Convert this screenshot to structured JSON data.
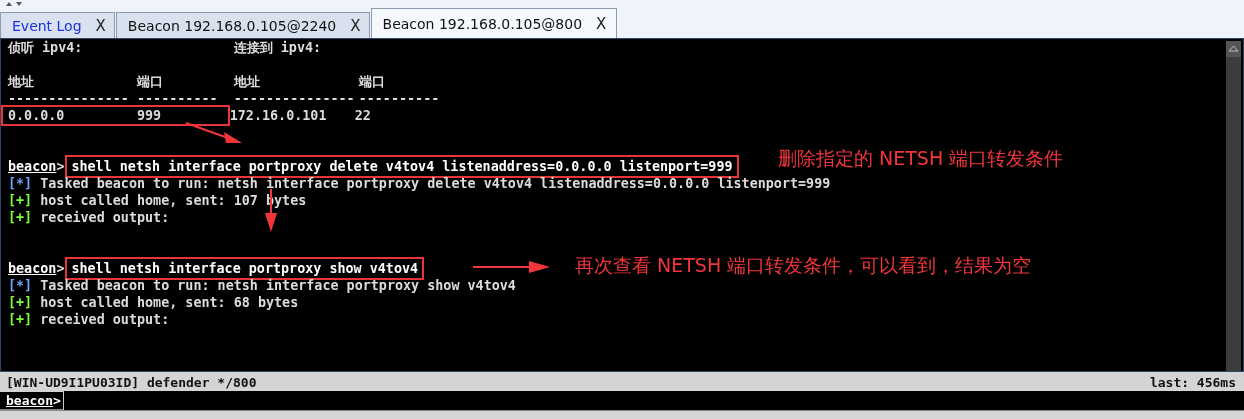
{
  "tabs": [
    {
      "label": "Event Log",
      "kind": "log",
      "close": "X",
      "selected": false
    },
    {
      "label": "Beacon 192.168.0.105@2240",
      "kind": "beacon",
      "close": "X",
      "selected": false
    },
    {
      "label": "Beacon 192.168.0.105@800",
      "kind": "beacon",
      "close": "X",
      "selected": true
    }
  ],
  "console": {
    "lines": [
      {
        "kind": "labels",
        "left": "侦听 ipv4:",
        "right": "连接到 ipv4:"
      },
      {
        "kind": "blank"
      },
      {
        "kind": "table",
        "columns": [
          {
            "header": "地址",
            "rule": "---------------"
          },
          {
            "header": "端口",
            "rule": "----------"
          },
          {
            "header": "地址",
            "rule": "---------------"
          },
          {
            "header": "端口",
            "rule": "----------"
          }
        ],
        "rows": [
          [
            {
              "text": "0.0.0.0",
              "highlighted": true
            },
            {
              "text": "999",
              "highlighted": true
            },
            {
              "text": "172.16.0.101",
              "highlighted": false
            },
            {
              "text": "22",
              "highlighted": false
            }
          ]
        ]
      },
      {
        "kind": "blank"
      },
      {
        "kind": "blank"
      },
      {
        "kind": "prompt",
        "prompt": "beacon",
        "sign": ">",
        "command": "shell netsh interface portproxy delete v4tov4 listenaddress=0.0.0.0 listenport=999",
        "highlighted": true
      },
      {
        "kind": "tasked",
        "marker": "[*]",
        "text": "Tasked beacon to run: netsh interface portproxy delete v4tov4 listenaddress=0.0.0.0 listenport=999"
      },
      {
        "kind": "info",
        "marker": "[+]",
        "text": "host called home, sent: 107 bytes"
      },
      {
        "kind": "info",
        "marker": "[+]",
        "text": "received output:"
      },
      {
        "kind": "blank"
      },
      {
        "kind": "blank"
      },
      {
        "kind": "prompt",
        "prompt": "beacon",
        "sign": ">",
        "command": "shell netsh interface portproxy show v4tov4",
        "highlighted": true
      },
      {
        "kind": "tasked",
        "marker": "[*]",
        "text": "Tasked beacon to run: netsh interface portproxy show v4tov4"
      },
      {
        "kind": "info",
        "marker": "[+]",
        "text": "host called home, sent: 68 bytes"
      },
      {
        "kind": "info",
        "marker": "[+]",
        "text": "received output:"
      }
    ],
    "annotations": [
      {
        "text": "删除指定的 NETSH 端口转发条件"
      },
      {
        "text": "再次查看 NETSH 端口转发条件，可以看到，结果为空"
      }
    ]
  },
  "status_bar": {
    "left": "[WIN-UD9I1PU03ID] defender */800",
    "right": "last: 456ms"
  },
  "input": {
    "prompt": "beacon",
    "sign": ">"
  }
}
